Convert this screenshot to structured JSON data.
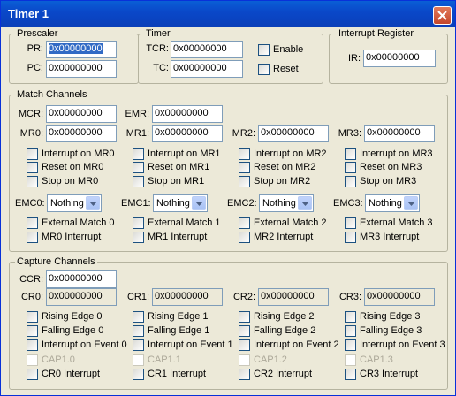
{
  "window": {
    "title": "Timer 1"
  },
  "prescaler": {
    "legend": "Prescaler",
    "pr_label": "PR:",
    "pr_value": "0x00000000",
    "pc_label": "PC:",
    "pc_value": "0x00000000"
  },
  "timer": {
    "legend": "Timer",
    "tcr_label": "TCR:",
    "tcr_value": "0x00000000",
    "tc_label": "TC:",
    "tc_value": "0x00000000",
    "enable_label": "Enable",
    "reset_label": "Reset"
  },
  "interrupt_register": {
    "legend": "Interrupt Register",
    "ir_label": "IR:",
    "ir_value": "0x00000000"
  },
  "match": {
    "legend": "Match Channels",
    "mcr_label": "MCR:",
    "mcr_value": "0x00000000",
    "emr_label": "EMR:",
    "emr_value": "0x00000000",
    "channels": [
      {
        "mr_label": "MR0:",
        "mr_value": "0x00000000",
        "int": "Interrupt on MR0",
        "reset": "Reset on MR0",
        "stop": "Stop on MR0",
        "emc_label": "EMC0:",
        "emc_value": "Nothing",
        "ext": "External Match 0",
        "mrint": "MR0 Interrupt"
      },
      {
        "mr_label": "MR1:",
        "mr_value": "0x00000000",
        "int": "Interrupt on MR1",
        "reset": "Reset on MR1",
        "stop": "Stop on MR1",
        "emc_label": "EMC1:",
        "emc_value": "Nothing",
        "ext": "External Match 1",
        "mrint": "MR1 Interrupt"
      },
      {
        "mr_label": "MR2:",
        "mr_value": "0x00000000",
        "int": "Interrupt on MR2",
        "reset": "Reset on MR2",
        "stop": "Stop on MR2",
        "emc_label": "EMC2:",
        "emc_value": "Nothing",
        "ext": "External Match 2",
        "mrint": "MR2 Interrupt"
      },
      {
        "mr_label": "MR3:",
        "mr_value": "0x00000000",
        "int": "Interrupt on MR3",
        "reset": "Reset on MR3",
        "stop": "Stop on MR3",
        "emc_label": "EMC3:",
        "emc_value": "Nothing",
        "ext": "External Match 3",
        "mrint": "MR3 Interrupt"
      }
    ]
  },
  "capture": {
    "legend": "Capture Channels",
    "ccr_label": "CCR:",
    "ccr_value": "0x00000000",
    "channels": [
      {
        "cr_label": "CR0:",
        "cr_value": "0x00000000",
        "rise": "Rising Edge 0",
        "fall": "Falling Edge 0",
        "ievt": "Interrupt on Event 0",
        "cap": "CAP1.0",
        "crint": "CR0 Interrupt"
      },
      {
        "cr_label": "CR1:",
        "cr_value": "0x00000000",
        "rise": "Rising Edge 1",
        "fall": "Falling Edge 1",
        "ievt": "Interrupt on Event 1",
        "cap": "CAP1.1",
        "crint": "CR1 Interrupt"
      },
      {
        "cr_label": "CR2:",
        "cr_value": "0x00000000",
        "rise": "Rising Edge 2",
        "fall": "Falling Edge 2",
        "ievt": "Interrupt on Event 2",
        "cap": "CAP1.2",
        "crint": "CR2 Interrupt"
      },
      {
        "cr_label": "CR3:",
        "cr_value": "0x00000000",
        "rise": "Rising Edge 3",
        "fall": "Falling Edge 3",
        "ievt": "Interrupt on Event 3",
        "cap": "CAP1.3",
        "crint": "CR3 Interrupt"
      }
    ]
  }
}
